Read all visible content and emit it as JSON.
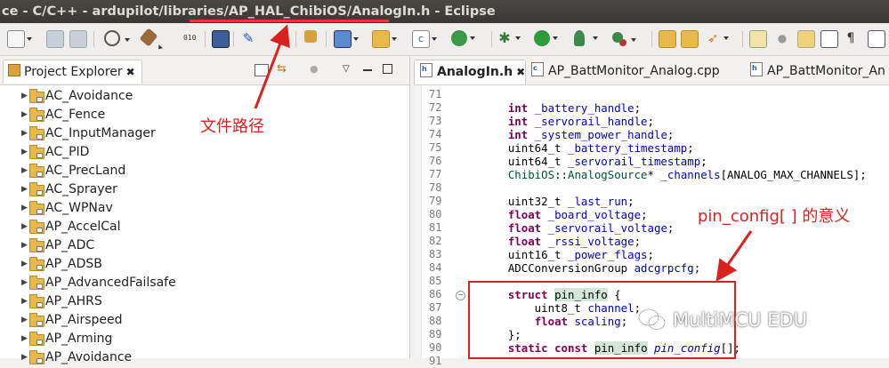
{
  "window": {
    "title": "ce - C/C++ - ardupilot/libraries/AP_HAL_ChibiOS/AnalogIn.h - Eclipse"
  },
  "toolbar": {
    "icons": [
      "new-icon",
      "save-icon",
      "save-all-icon",
      "build-icon",
      "hammer-icon",
      "binary-icon",
      "terminal-icon",
      "pin-icon",
      "include-browser-icon",
      "new-class-icon",
      "new-folder-icon",
      "new-source-icon",
      "refresh-icon",
      "debug-icon",
      "run-icon",
      "coverage-icon",
      "external-tools-icon",
      "open-type-icon",
      "open-folder-icon",
      "search-icon",
      "edit-icon",
      "mark-icon",
      "tasks-icon",
      "outline-icon",
      "paragraph-icon",
      "console-icon"
    ]
  },
  "explorer": {
    "title": "Project Explorer",
    "items": [
      "AC_Avoidance",
      "AC_Fence",
      "AC_InputManager",
      "AC_PID",
      "AC_PrecLand",
      "AC_Sprayer",
      "AC_WPNav",
      "AP_AccelCal",
      "AP_ADC",
      "AP_ADSB",
      "AP_AdvancedFailsafe",
      "AP_AHRS",
      "AP_Airspeed",
      "AP_Arming",
      "AP_Avoidance"
    ]
  },
  "editor": {
    "tabs": [
      "AnalogIn.h",
      "AP_BattMonitor_Analog.cpp",
      "AP_BattMonitor_An"
    ],
    "lines": [
      {
        "n": "71",
        "code": ""
      },
      {
        "n": "72",
        "code": "    int _battery_handle;"
      },
      {
        "n": "73",
        "code": "    int _servorail_handle;"
      },
      {
        "n": "74",
        "code": "    int _system_power_handle;"
      },
      {
        "n": "75",
        "code": "    uint64_t _battery_timestamp;"
      },
      {
        "n": "76",
        "code": "    uint64_t _servorail_timestamp;"
      },
      {
        "n": "77",
        "code": "    ChibiOS::AnalogSource* _channels[ANALOG_MAX_CHANNELS];"
      },
      {
        "n": "78",
        "code": ""
      },
      {
        "n": "79",
        "code": "    uint32_t _last_run;"
      },
      {
        "n": "80",
        "code": "    float _board_voltage;"
      },
      {
        "n": "81",
        "code": "    float _servorail_voltage;"
      },
      {
        "n": "82",
        "code": "    float _rssi_voltage;"
      },
      {
        "n": "83",
        "code": "    uint16_t _power_flags;"
      },
      {
        "n": "84",
        "code": "    ADCConversionGroup adcgrpcfg;"
      },
      {
        "n": "85",
        "code": ""
      },
      {
        "n": "86",
        "code": "    struct pin_info {"
      },
      {
        "n": "87",
        "code": "        uint8_t channel;"
      },
      {
        "n": "88",
        "code": "        float scaling;"
      },
      {
        "n": "89",
        "code": "    };"
      },
      {
        "n": "90",
        "code": "    static const pin_info pin_config[];"
      },
      {
        "n": "91",
        "code": ""
      }
    ]
  },
  "annotations": {
    "file_path": "文件路径",
    "pin_config": "pin_config[ ] 的意义"
  },
  "watermark": "MultiMCU EDU",
  "colors": {
    "annotation": "#d9211e",
    "keyword": "#7f0055",
    "field": "#0000c0",
    "title_bar": "#3f3d3a"
  }
}
